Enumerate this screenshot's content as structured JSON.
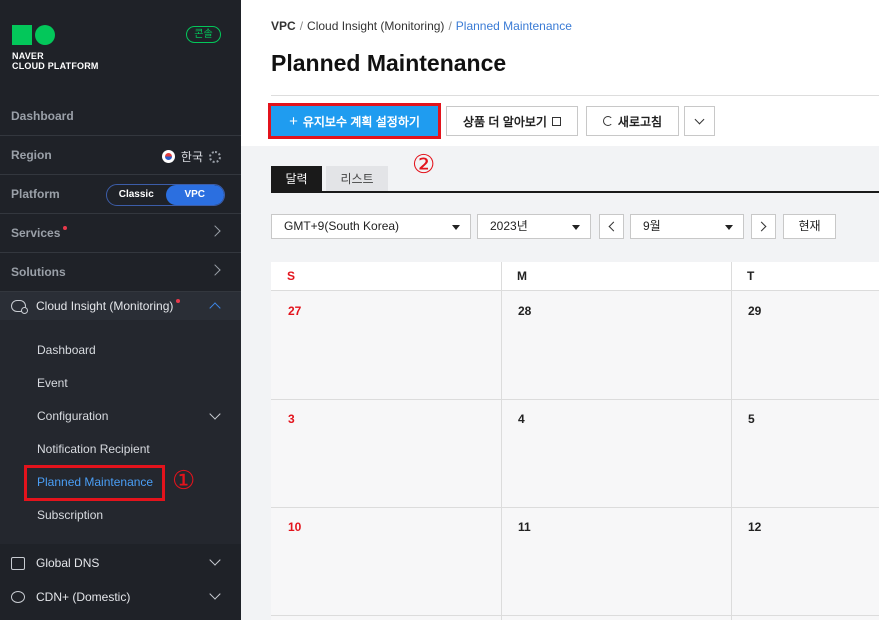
{
  "sidebar": {
    "logo_text_line1": "NAVER",
    "logo_text_line2": "CLOUD PLATFORM",
    "console_badge": "콘솔",
    "dashboard": "Dashboard",
    "region": {
      "label": "Region",
      "value": "한국"
    },
    "platform": {
      "label": "Platform",
      "options": [
        "Classic",
        "VPC"
      ],
      "selected": "VPC"
    },
    "services": "Services",
    "solutions": "Solutions",
    "cloud_insight": "Cloud Insight (Monitoring)",
    "submenu": [
      "Dashboard",
      "Event",
      "Configuration",
      "Notification Recipient",
      "Planned Maintenance",
      "Subscription"
    ],
    "active_submenu": "Planned Maintenance",
    "global_dns": "Global DNS",
    "cdn": "CDN+ (Domestic)"
  },
  "annotations": {
    "one": "①",
    "two": "②"
  },
  "breadcrumb": {
    "root": "VPC",
    "sep": "/",
    "parent": "Cloud Insight (Monitoring)",
    "current": "Planned Maintenance"
  },
  "page_title": "Planned Maintenance",
  "toolbar": {
    "create_label": "유지보수 계획 설정하기",
    "learn_more_label": "상품 더 알아보기",
    "refresh_label": "새로고침"
  },
  "tabs": [
    "달력",
    "리스트"
  ],
  "filters": {
    "timezone": "GMT+9(South Korea)",
    "year": "2023년",
    "month": "9월",
    "today_label": "현재"
  },
  "calendar": {
    "weekdays": [
      "S",
      "M",
      "T"
    ],
    "rows": [
      [
        "27",
        "28",
        "29"
      ],
      [
        "3",
        "4",
        "5"
      ],
      [
        "10",
        "11",
        "12"
      ]
    ]
  },
  "colors": {
    "accent": "#1f9cf0",
    "highlight": "#e3131c",
    "brand": "#03c75a",
    "sidebar_bg": "#1f2228"
  }
}
